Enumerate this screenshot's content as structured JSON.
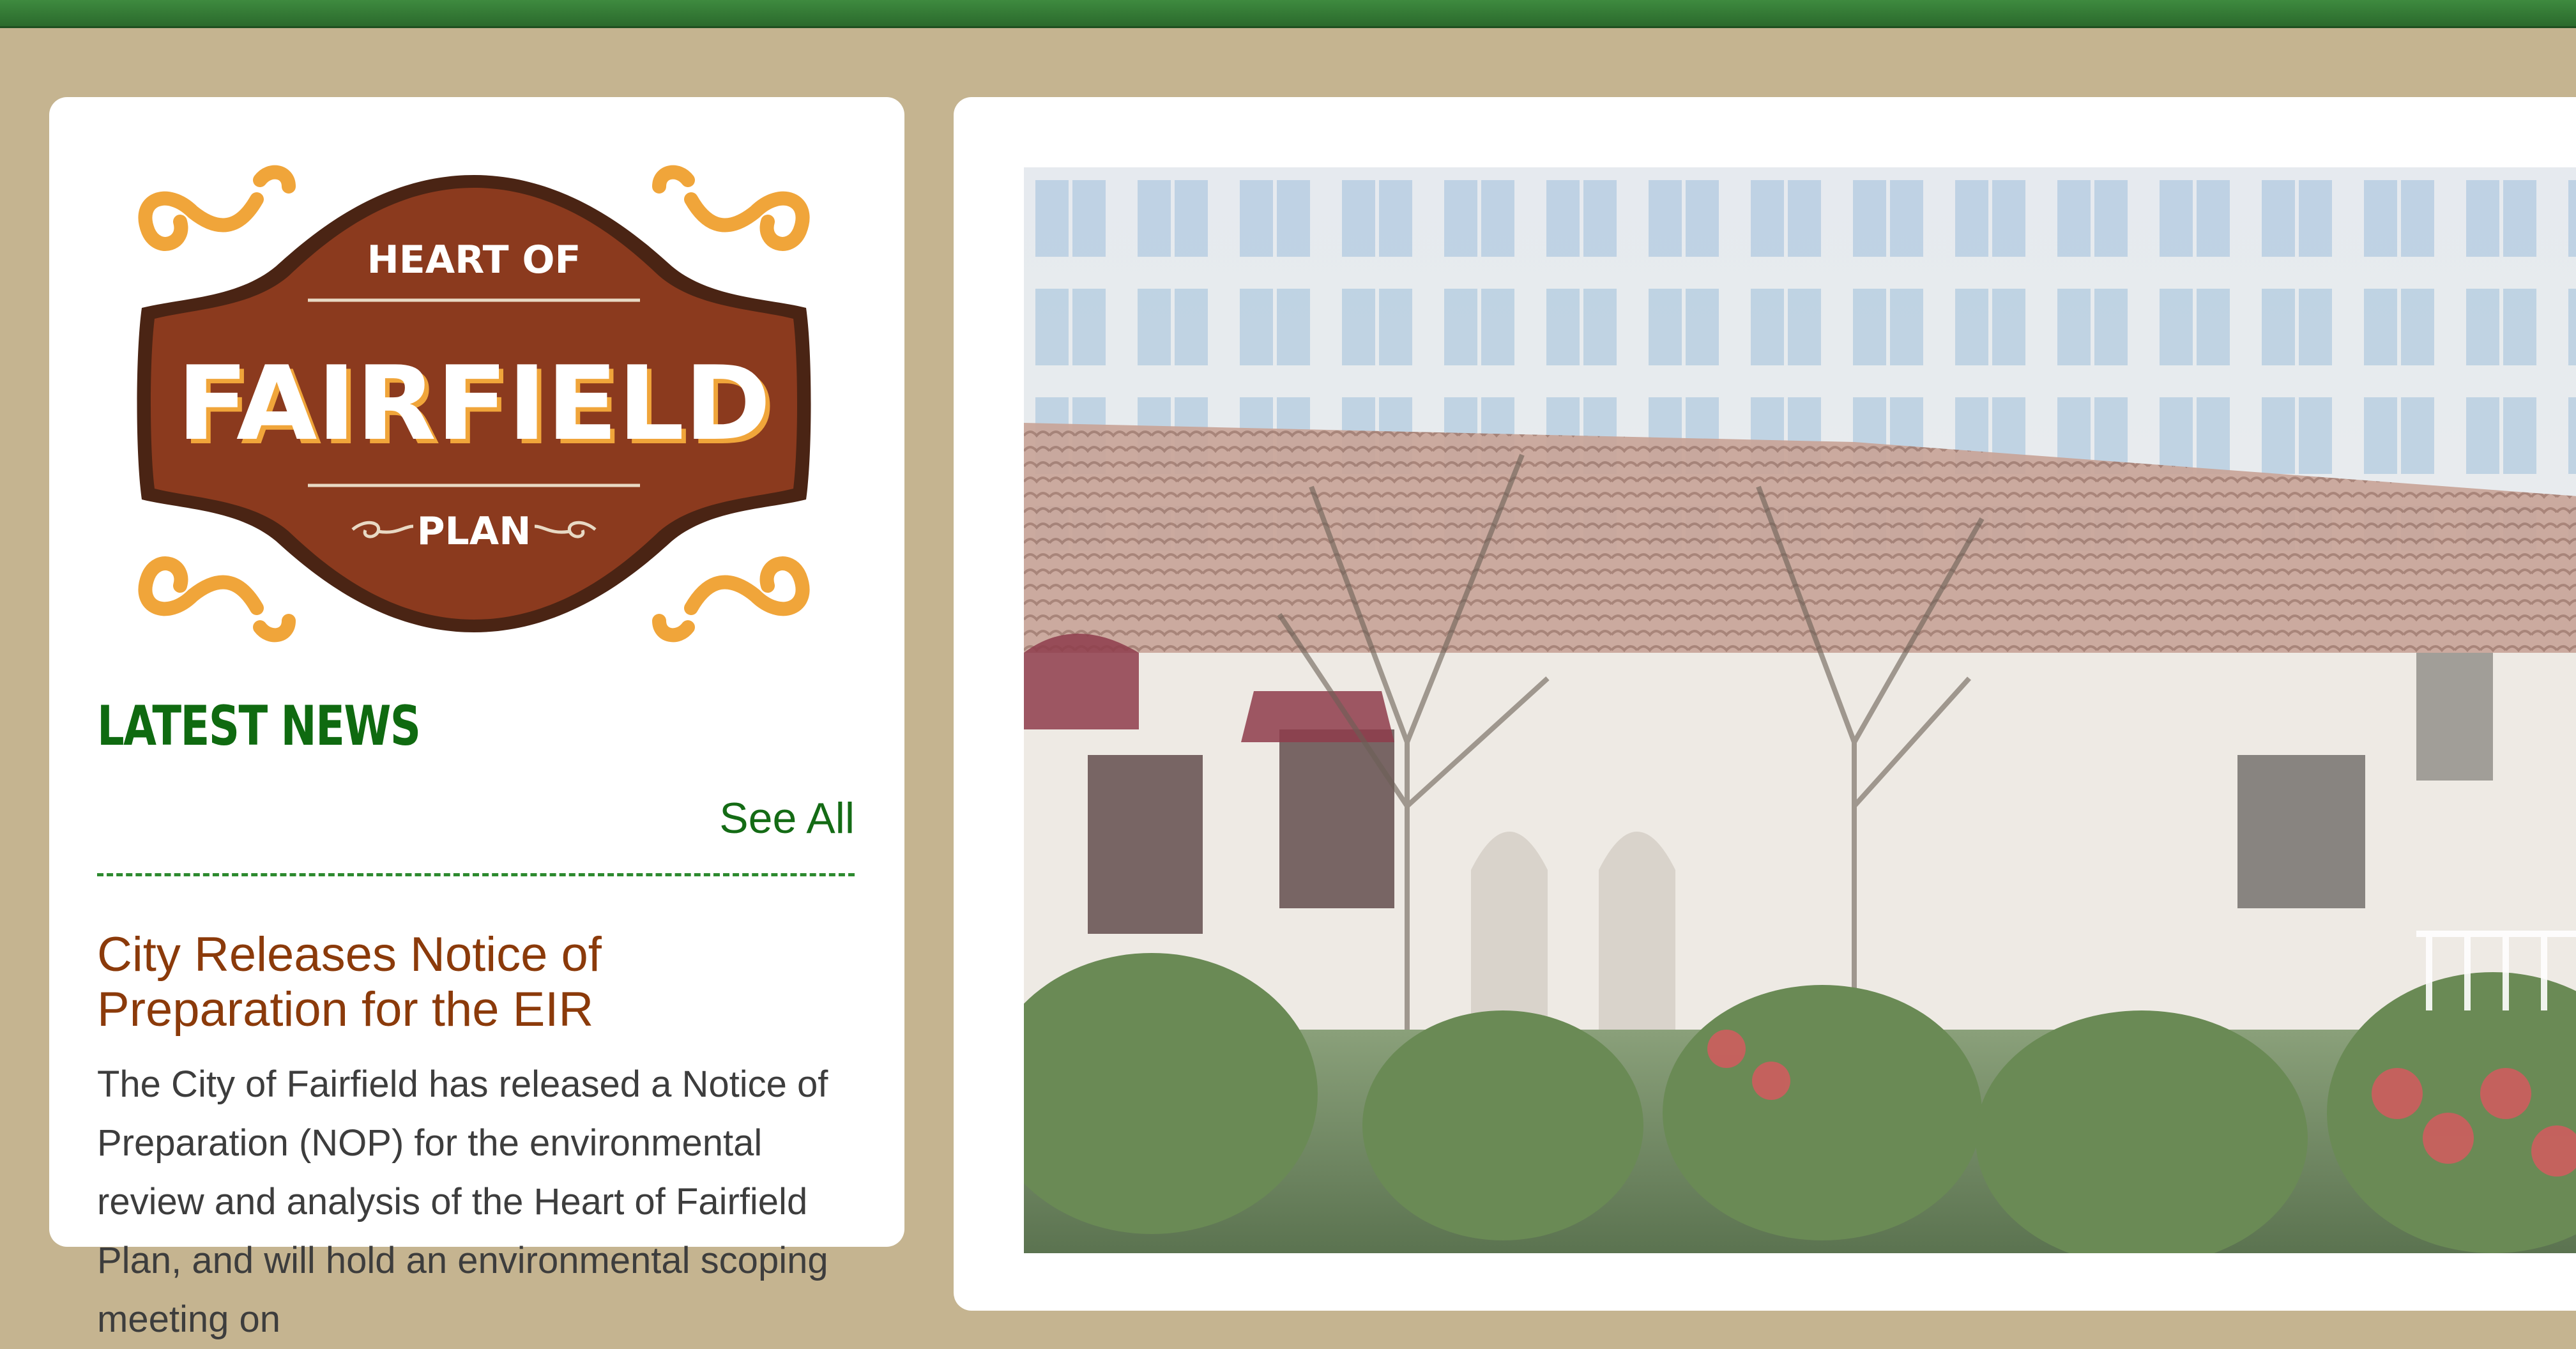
{
  "logo": {
    "line1": "HEART OF",
    "line2": "FAIRFIELD",
    "line3": "PLAN"
  },
  "news": {
    "heading": "LATEST NEWS",
    "see_all": "See All",
    "article": {
      "title": "City Releases Notice of Preparation for the EIR",
      "body": "The City of Fairfield has released a Notice of Preparation (NOP) for the environmental review and analysis of the Heart of Fairfield Plan, and will hold an environmental scoping meeting on"
    }
  },
  "colors": {
    "top_bar": "#2f7a31",
    "page_background": "#c5b490",
    "news_green": "#0f6a10",
    "article_title": "#8b3a0a",
    "logo_brown": "#8b3a1e",
    "logo_gold": "#f0a53a"
  }
}
